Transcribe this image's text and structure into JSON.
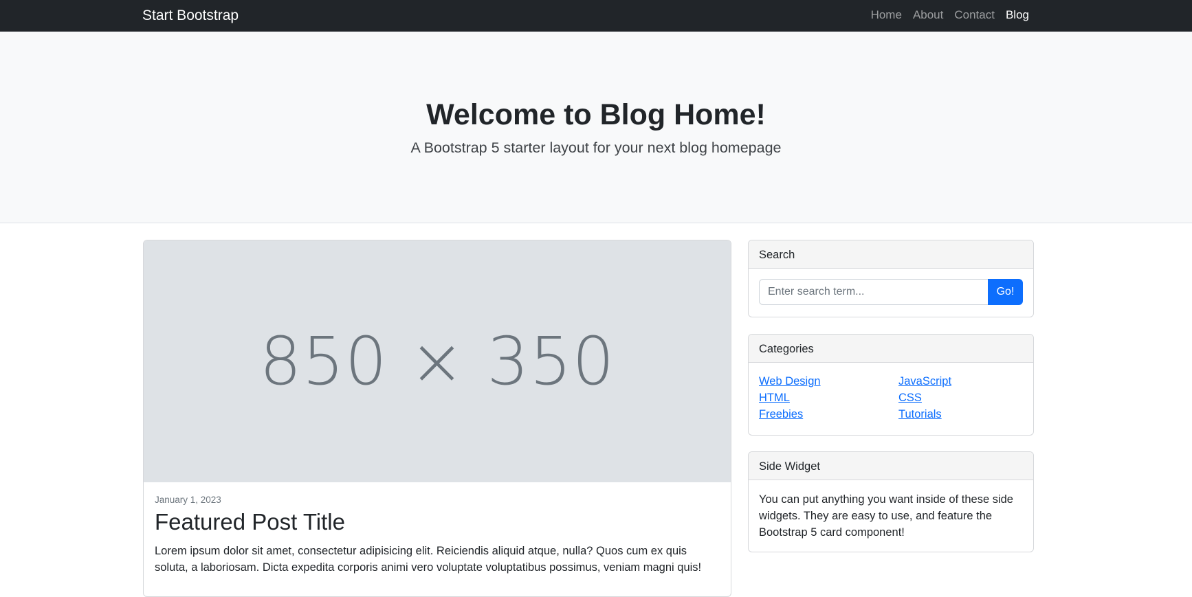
{
  "navbar": {
    "brand": "Start Bootstrap",
    "links": [
      {
        "label": "Home",
        "active": false
      },
      {
        "label": "About",
        "active": false
      },
      {
        "label": "Contact",
        "active": false
      },
      {
        "label": "Blog",
        "active": true
      }
    ]
  },
  "hero": {
    "title": "Welcome to Blog Home!",
    "subtitle": "A Bootstrap 5 starter layout for your next blog homepage"
  },
  "featured_post": {
    "image_placeholder": "850 × 350",
    "date": "January 1, 2023",
    "title": "Featured Post Title",
    "excerpt": "Lorem ipsum dolor sit amet, consectetur adipisicing elit. Reiciendis aliquid atque, nulla? Quos cum ex quis soluta, a laboriosam. Dicta expedita corporis animi vero voluptate voluptatibus possimus, veniam magni quis!"
  },
  "sidebar": {
    "search": {
      "header": "Search",
      "placeholder": "Enter search term...",
      "button": "Go!"
    },
    "categories": {
      "header": "Categories",
      "items": [
        "Web Design",
        "JavaScript",
        "HTML",
        "CSS",
        "Freebies",
        "Tutorials"
      ]
    },
    "side_widget": {
      "header": "Side Widget",
      "text": "You can put anything you want inside of these side widgets. They are easy to use, and feature the Bootstrap 5 card component!"
    }
  },
  "colors": {
    "navbar_bg": "#212529",
    "hero_bg": "#f8f9fa",
    "primary": "#0d6efd",
    "placeholder_bg": "#dee2e6"
  }
}
